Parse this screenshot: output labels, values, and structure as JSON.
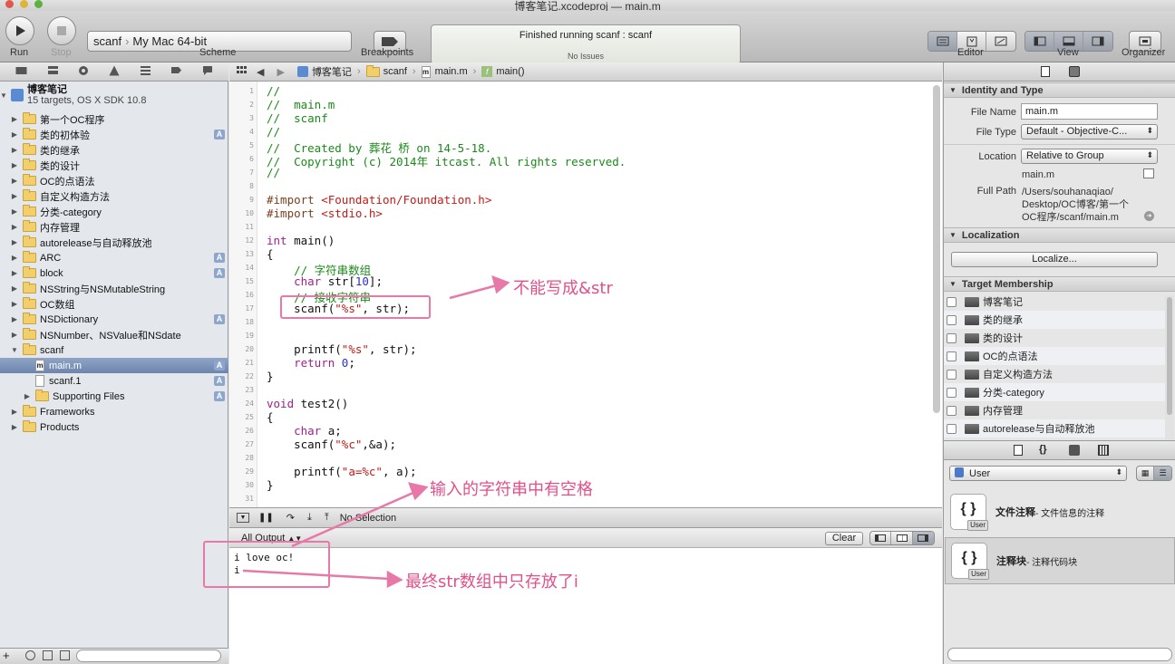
{
  "window": {
    "title": "博客笔记.xcodeproj  —  main.m"
  },
  "toolbar": {
    "run_label": "Run",
    "stop_label": "Stop",
    "scheme_target": "scanf",
    "scheme_device": "My Mac 64-bit",
    "scheme_label": "Scheme",
    "breakpoints_label": "Breakpoints",
    "status_title": "Finished running scanf : scanf",
    "status_issues": "No Issues",
    "editor_label": "Editor",
    "view_label": "View",
    "organizer_label": "Organizer"
  },
  "navigator": {
    "project_name": "博客笔记",
    "project_sub": "15 targets, OS X SDK 10.8",
    "items": [
      {
        "label": "第一个OC程序",
        "badge": ""
      },
      {
        "label": "类的初体验",
        "badge": "A"
      },
      {
        "label": "类的继承",
        "badge": ""
      },
      {
        "label": "类的设计",
        "badge": ""
      },
      {
        "label": "OC的点语法",
        "badge": ""
      },
      {
        "label": "自定义构造方法",
        "badge": ""
      },
      {
        "label": "分类-category",
        "badge": ""
      },
      {
        "label": "内存管理",
        "badge": ""
      },
      {
        "label": "autorelease与自动释放池",
        "badge": ""
      },
      {
        "label": "ARC",
        "badge": "A"
      },
      {
        "label": "block",
        "badge": "A"
      },
      {
        "label": "NSString与NSMutableString",
        "badge": ""
      },
      {
        "label": "OC数组",
        "badge": ""
      },
      {
        "label": "NSDictionary",
        "badge": "A"
      },
      {
        "label": "NSNumber、NSValue和NSdate",
        "badge": ""
      },
      {
        "label": "scanf",
        "badge": ""
      },
      {
        "label": "main.m",
        "badge": "A"
      },
      {
        "label": "scanf.1",
        "badge": "A"
      },
      {
        "label": "Supporting Files",
        "badge": "A"
      },
      {
        "label": "Frameworks",
        "badge": ""
      },
      {
        "label": "Products",
        "badge": ""
      }
    ]
  },
  "jumpbar": {
    "project": "博客笔记",
    "group": "scanf",
    "file": "main.m",
    "symbol": "main()"
  },
  "editor": {
    "line_numbers": [
      "1",
      "2",
      "3",
      "4",
      "5",
      "6",
      "7",
      "8",
      "9",
      "10",
      "11",
      "12",
      "13",
      "14",
      "15",
      "16",
      "17",
      "18",
      "19",
      "20",
      "21",
      "22",
      "23",
      "24",
      "25",
      "26",
      "27",
      "28",
      "29",
      "30",
      "31"
    ],
    "l1": "//",
    "l2": "//  main.m",
    "l3": "//  scanf",
    "l4": "//",
    "l5": "//  Created by 葬花 桥 on 14-5-18.",
    "l6": "//  Copyright (c) 2014年 itcast. All rights reserved.",
    "l7": "//",
    "l9_a": "#import ",
    "l9_b": "<Foundation/Foundation.h>",
    "l10_a": "#import ",
    "l10_b": "<stdio.h>",
    "l12_kw": "int",
    "l12_rest": " main()",
    "l13": "{",
    "l14": "    // 字符串数组",
    "l15_kw": "    char",
    "l15_a": " str[",
    "l15_n": "10",
    "l15_b": "];",
    "l16": "    // 接收字符串",
    "l17_a": "    scanf(",
    "l17_s": "\"%s\"",
    "l17_b": ", str);",
    "l20_a": "    printf(",
    "l20_s": "\"%s\"",
    "l20_b": ", str);",
    "l21_kw": "    return",
    "l21_n": " 0",
    "l21_b": ";",
    "l22": "}",
    "l24_kw": "void",
    "l24_rest": " test2()",
    "l25": "{",
    "l26_kw": "    char",
    "l26_rest": " a;",
    "l27_a": "    scanf(",
    "l27_s": "\"%c\"",
    "l27_b": ",&a);",
    "l29_a": "    printf(",
    "l29_s": "\"a=%c\"",
    "l29_b": ", a);",
    "l30": "}"
  },
  "debug": {
    "selection": "No Selection",
    "output_selector": "All Output",
    "clear_label": "Clear"
  },
  "console": {
    "line1": "i love oc!",
    "line2": "i"
  },
  "inspector": {
    "identity_title": "Identity and Type",
    "file_name_label": "File Name",
    "file_name_value": "main.m",
    "file_type_label": "File Type",
    "file_type_value": "Default - Objective-C...",
    "location_label": "Location",
    "location_value": "Relative to Group",
    "location_file": "main.m",
    "full_path_label": "Full Path",
    "full_path_1": "/Users/souhanaqiao/",
    "full_path_2": "Desktop/OC博客/第一个",
    "full_path_3": "OC程序/scanf/main.m",
    "localization_title": "Localization",
    "localize_button": "Localize...",
    "target_title": "Target Membership",
    "targets": [
      "博客笔记",
      "类的继承",
      "类的设计",
      "OC的点语法",
      "自定义构造方法",
      "分类-category",
      "内存管理",
      "autorelease与自动释放池"
    ],
    "library_popup": "User",
    "snippets": [
      {
        "title": "文件注释",
        "desc": " - 文件信息的注释",
        "badge": "User"
      },
      {
        "title": "注释块",
        "desc": " - 注释代码块",
        "badge": "User"
      }
    ]
  },
  "annotations": {
    "a1": "不能写成&str",
    "a2": "输入的字符串中有空格",
    "a3": "最终str数组中只存放了i"
  },
  "colors": {
    "annotation": "#e2508a",
    "comment": "#1a8a1a",
    "keyword": "#a2208c",
    "string": "#c41a16",
    "number": "#2b30c8",
    "selection": "#7088b0"
  }
}
